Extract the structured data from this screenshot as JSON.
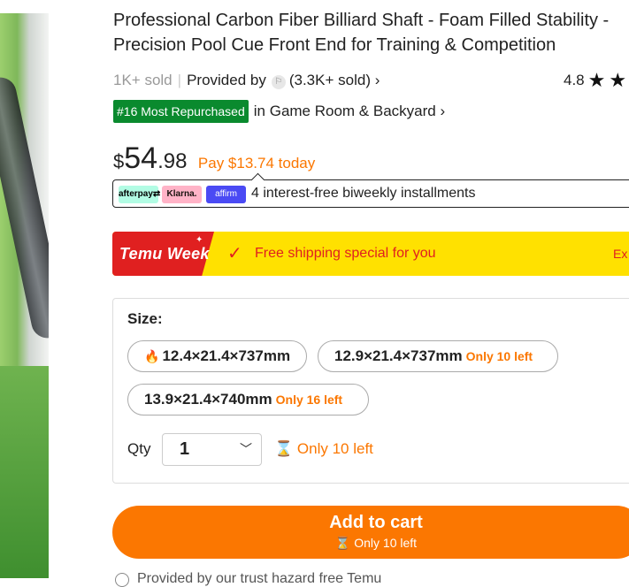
{
  "product": {
    "title": "Professional Carbon Fiber Billiard Shaft - Foam Filled Stability - Precision Pool Cue Front End for Training & Competition",
    "sold": "1K+ sold",
    "separator": "|",
    "provided_by": "Provided by",
    "store_sold": "(3.3K+ sold)",
    "store_chevron": "›",
    "rating": "4.8",
    "rank_badge": "#16 Most Repurchased",
    "rank_category": "in Game Room & Backyard ›"
  },
  "price": {
    "currency": "$",
    "whole": "54",
    "fraction": ".98",
    "pay_today": "Pay $13.74 today"
  },
  "installments": {
    "providers": [
      "afterpay⇄",
      "Klarna.",
      "affirm"
    ],
    "text": "4 interest-free biweekly installments"
  },
  "promo": {
    "event": "Temu Week",
    "message": "Free shipping special for you",
    "extra": "Ex",
    "colors": {
      "banner": "#ffe100",
      "tag": "#e02020"
    }
  },
  "options": {
    "size_label": "Size:",
    "sizes": [
      {
        "label": "12.4×21.4×737mm",
        "stock": "",
        "selected_icon": "fire-icon"
      },
      {
        "label": "12.9×21.4×737mm",
        "stock": "Only 10 left"
      },
      {
        "label": "13.9×21.4×740mm",
        "stock": "Only 16 left"
      }
    ],
    "qty_label": "Qty",
    "qty_value": "1",
    "qty_stock": "Only 10 left"
  },
  "cart": {
    "label": "Add to cart",
    "stock": "Only 10 left"
  },
  "footer": {
    "text": "Provided by our trust hazard free Temu"
  },
  "colors": {
    "accent": "#fb7701",
    "badge": "#0a8a2e"
  }
}
